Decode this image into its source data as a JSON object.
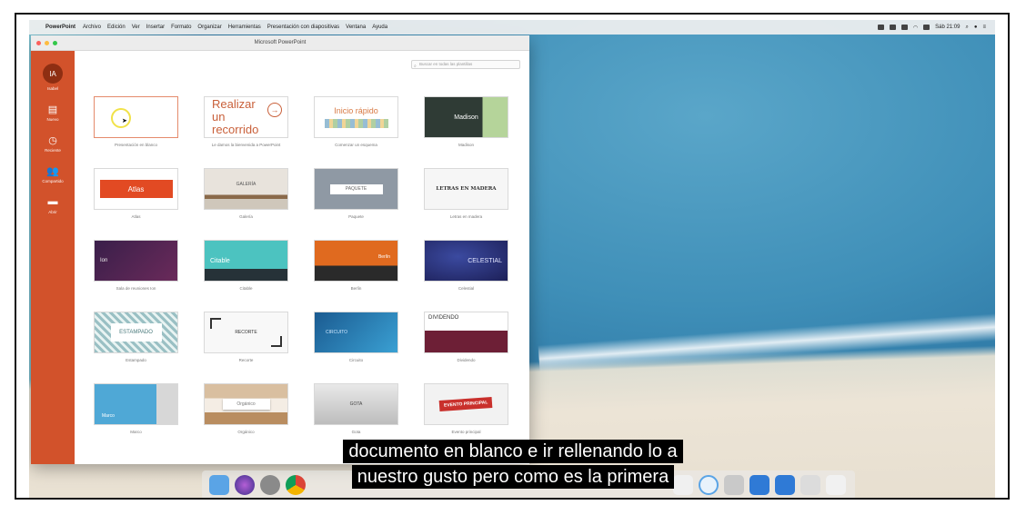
{
  "menubar": {
    "app": "PowerPoint",
    "items": [
      "Archivo",
      "Edición",
      "Ver",
      "Insertar",
      "Formato",
      "Organizar",
      "Herramientas",
      "Presentación con diapositivas",
      "Ventana",
      "Ayuda"
    ],
    "clock": "Sáb 21:09"
  },
  "window": {
    "title": "Microsoft PowerPoint",
    "search_placeholder": "Buscar en todas las plantillas"
  },
  "sidebar": {
    "avatar_initials": "IA",
    "user": "Isabel",
    "items": [
      {
        "label": "Nuevo",
        "icon": "new-doc-icon"
      },
      {
        "label": "Reciente",
        "icon": "clock-icon"
      },
      {
        "label": "Compartido",
        "icon": "people-icon"
      },
      {
        "label": "Abrir",
        "icon": "folder-icon"
      }
    ]
  },
  "templates": [
    {
      "thumb": "",
      "caption": "Presentación en blanco"
    },
    {
      "thumb": "Realizar un recorrido",
      "caption": "Le damos la bienvenida a PowerPoint"
    },
    {
      "thumb": "Inicio rápido",
      "caption": "Comenzar un esquema"
    },
    {
      "thumb": "Madison",
      "caption": "Madison"
    },
    {
      "thumb": "Atlas",
      "caption": "Atlas"
    },
    {
      "thumb": "GALERÍA",
      "caption": "Galería"
    },
    {
      "thumb": "PAQUETE",
      "caption": "Paquete"
    },
    {
      "thumb": "LETRAS EN MADERA",
      "caption": "Letras en madera"
    },
    {
      "thumb": "Ion",
      "caption": "Sala de reuniones Ion"
    },
    {
      "thumb": "Citable",
      "caption": "Citable"
    },
    {
      "thumb": "Berlín",
      "caption": "Berlín"
    },
    {
      "thumb": "CELESTIAL",
      "caption": "Celestial"
    },
    {
      "thumb": "ESTAMPADO",
      "caption": "Estampado"
    },
    {
      "thumb": "RECORTE",
      "caption": "Recorte"
    },
    {
      "thumb": "CIRCUITO",
      "caption": "Circuito"
    },
    {
      "thumb": "DIVIDENDO",
      "caption": "Dividendo"
    },
    {
      "thumb": "Marco",
      "caption": "Marco"
    },
    {
      "thumb": "Orgánico",
      "caption": "Orgánico"
    },
    {
      "thumb": "GOTA",
      "caption": "Gota"
    },
    {
      "thumb": "EVENTO PRINCIPAL",
      "caption": "Evento principal"
    }
  ],
  "subtitles": {
    "line1": "documento en blanco e ir rellenando lo a",
    "line2": "nuestro gusto pero como es la primera"
  },
  "colors": {
    "accent": "#d2522b",
    "traffic_red": "#fc605c",
    "traffic_yellow": "#fdbc40",
    "traffic_green": "#34c84a"
  }
}
